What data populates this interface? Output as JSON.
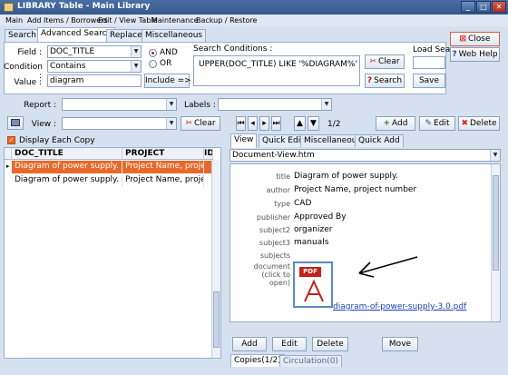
{
  "window": {
    "title": "LIBRARY Table - Main Library",
    "minimize": "_",
    "maximize": "□",
    "close": "✕"
  },
  "menu": [
    "Main",
    "Add Items / Borrowers",
    "Edit / View Table",
    "Maintenance",
    "Backup / Restore"
  ],
  "tabs": [
    "Search",
    "Advanced Search",
    "Replace",
    "Miscellaneous"
  ],
  "search": {
    "field_label": "Field :",
    "field_value": "DOC_TITLE",
    "condition_label": "Condition :",
    "condition_value": "Contains",
    "value_label": "Value :",
    "value_value": "diagram",
    "and_label": "AND",
    "or_label": "OR",
    "include_label": "Include =>",
    "conditions_label": "Search Conditions :",
    "conditions_text": "UPPER(DOC_TITLE) LIKE '%DIAGRAM%'",
    "clear_label": "Clear",
    "search_label": "Search",
    "load_label": "Load Sea",
    "save_label": "Save"
  },
  "side": {
    "close_label": "Close",
    "webhelp_label": "Web Help"
  },
  "report": {
    "report_label": "Report :",
    "labels_label": "Labels :",
    "view_label": "View :",
    "clear_label": "Clear"
  },
  "nav": {
    "counter": "1/2",
    "add": "Add",
    "edit": "Edit",
    "delete": "Delete"
  },
  "list": {
    "display_each_copy": "Display Each Copy",
    "columns": [
      "DOC_TITLE",
      "PROJECT",
      "ID"
    ],
    "rows": [
      {
        "title": "Diagram of power supply.",
        "project": "Project Name, project",
        "id": ""
      },
      {
        "title": "Diagram of power supply.",
        "project": "Project Name, project",
        "id": ""
      }
    ]
  },
  "right_tabs": [
    "View",
    "Quick Edit",
    "Miscellaneous",
    "Quick Add"
  ],
  "view_template": "Document-View.htm",
  "record": [
    {
      "key": "title",
      "value": "Diagram of power supply."
    },
    {
      "key": "author",
      "value": "Project Name, project number"
    },
    {
      "key": "type",
      "value": "CAD"
    },
    {
      "key": "publisher",
      "value": "Approved By"
    },
    {
      "key": "subject2",
      "value": "organizer"
    },
    {
      "key": "subject3",
      "value": "manuals"
    },
    {
      "key": "subjects",
      "value": ""
    }
  ],
  "document": {
    "key_lines": [
      "document",
      "(click to",
      "open)"
    ],
    "pdf_badge": "PDF",
    "file_link": "diagram-of-power-supply-3.0.pdf"
  },
  "bottom": {
    "add": "Add",
    "edit": "Edit",
    "delete": "Delete",
    "move": "Move",
    "tabs": [
      "Copies(1/2)",
      "Circulation(0)"
    ]
  },
  "icons": [
    "app-icon",
    "close-icon",
    "help-icon",
    "clear-icon",
    "search-icon",
    "add-icon",
    "edit-icon",
    "delete-icon",
    "arrow-icon",
    "pdf-icon"
  ],
  "colors": {
    "selection": "#e8692a",
    "link": "#1a3fbf",
    "close_accent": "#d8241f"
  }
}
